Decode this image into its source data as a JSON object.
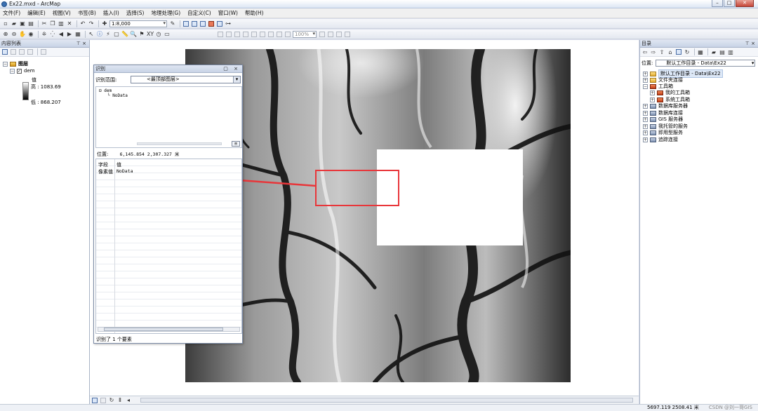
{
  "window": {
    "title": "Ex22.mxd - ArcMap",
    "controls": [
      "–",
      "□",
      "✕"
    ]
  },
  "menu": [
    "文件(F)",
    "编辑(E)",
    "视图(V)",
    "书签(B)",
    "插入(I)",
    "选择(S)",
    "地理处理(G)",
    "自定义(C)",
    "窗口(W)",
    "帮助(H)"
  ],
  "toolbar": {
    "scale": "1:8,000",
    "zoom": "100%"
  },
  "toc": {
    "title": "内容列表",
    "pin": "⊤ ×",
    "layers_group": "图层",
    "layer_name": "dem",
    "value_label": "值",
    "high": "高 : 1083.69",
    "low": "低 : 868.207"
  },
  "identify": {
    "title": "识别",
    "range_label": "识别范围:",
    "range_value": "<最顶部图层>",
    "tree_root": "dem",
    "tree_child": "NoData",
    "location_label": "位置:",
    "location_value": "6,145.854  2,307.327 米",
    "col_field": "字段",
    "col_value": "值",
    "field_name": "像素值",
    "field_value": "NoData",
    "status": "识别了 1 个要素",
    "ctrls": "▢ ×"
  },
  "catalog": {
    "title": "目录",
    "pin": "⊤ ×",
    "location_label": "位置:",
    "location_value": "默认工作目录 - Data\\Ex22",
    "items": [
      {
        "label": "默认工作目录 - Data\\Ex22",
        "icon": "folder",
        "expander": "+"
      },
      {
        "label": "文件夹连接",
        "icon": "folder",
        "expander": "+"
      },
      {
        "label": "工具箱",
        "icon": "toolbox",
        "expander": "−"
      },
      {
        "label": "我的工具箱",
        "icon": "toolbox",
        "expander": "+"
      },
      {
        "label": "系统工具箱",
        "icon": "toolbox",
        "expander": "+"
      },
      {
        "label": "数据库服务器",
        "icon": "server",
        "expander": "+"
      },
      {
        "label": "数据库连接",
        "icon": "server",
        "expander": "+"
      },
      {
        "label": "GIS 服务器",
        "icon": "server",
        "expander": "+"
      },
      {
        "label": "我托管的服务",
        "icon": "server",
        "expander": "+"
      },
      {
        "label": "即用型服务",
        "icon": "server",
        "expander": "+"
      },
      {
        "label": "追踪连接",
        "icon": "server",
        "expander": "+"
      }
    ]
  },
  "status": {
    "coords": "5697.119  2508.41 米",
    "watermark": "CSDN @刘一哥GIS"
  },
  "colors": {
    "highlight": "#e8363a",
    "panel_header": "#c8d3e6"
  }
}
